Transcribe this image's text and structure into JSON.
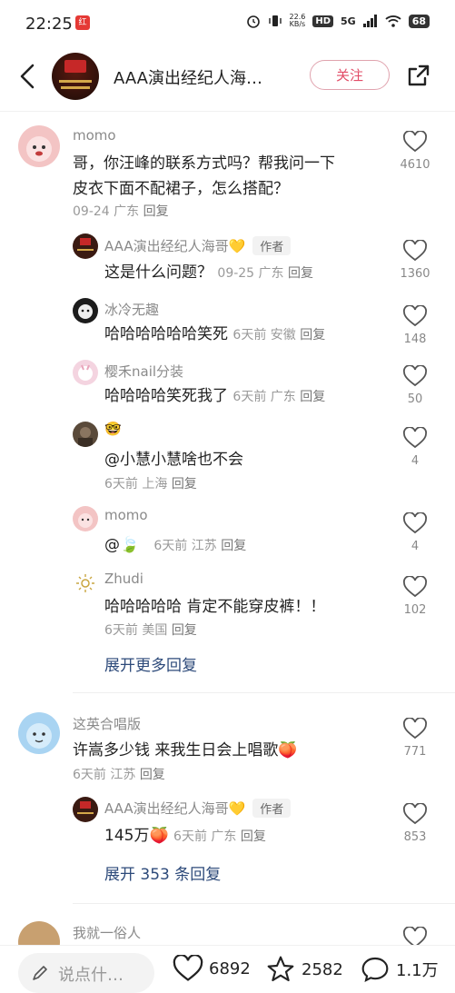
{
  "status_bar": {
    "time": "22:25",
    "app_icon_label": "红",
    "net_speed_value": "22.6",
    "net_speed_unit": "KB/s",
    "hd": "HD",
    "network": "5G",
    "battery": "68"
  },
  "header": {
    "title": "AAA演出经纪人海…",
    "follow_label": "关注"
  },
  "comments": [
    {
      "username": "momo",
      "text_lines": [
        "哥，你汪峰的联系方式吗？帮我问一下",
        "皮衣下面不配裙子，怎么搭配？"
      ],
      "meta": "09-24 广东",
      "reply_label": "回复",
      "likes": "4610",
      "avatar_color": "#f3c4c4",
      "replies": [
        {
          "username": "AAA演出经纪人海哥💛",
          "tag": "作者",
          "text": "这是什么问题？",
          "meta_inline": "09-25 广东",
          "reply_label": "回复",
          "likes": "1360",
          "avatar_color": "#3a1a12"
        },
        {
          "username": "冰冷无趣",
          "text": "哈哈哈哈哈哈笑死",
          "meta_inline": "6天前 安徽",
          "reply_label": "回复",
          "likes": "148",
          "avatar_color": "#1c1c1c"
        },
        {
          "username": "樱禾nail分装",
          "text": "哈哈哈哈笑死我了",
          "meta_inline": "6天前 广东",
          "reply_label": "回复",
          "likes": "50",
          "avatar_color": "#f4d4e0"
        },
        {
          "username": "🤓",
          "text": "@小慧小慧啥也不会",
          "meta": "6天前 上海",
          "reply_label": "回复",
          "likes": "4",
          "avatar_color": "#5a4a3a"
        },
        {
          "username": "momo",
          "text": "@🍃",
          "meta_inline": "6天前 江苏",
          "reply_label": "回复",
          "likes": "4",
          "avatar_color": "#f3c4c4"
        },
        {
          "username": "Zhudi",
          "text": "哈哈哈哈哈 肯定不能穿皮裤！！",
          "meta": "6天前 美国",
          "reply_label": "回复",
          "likes": "102",
          "avatar_color": "#ffffff"
        }
      ],
      "expand_label": "展开更多回复"
    },
    {
      "username": "这英合唱版",
      "text_lines": [
        "许嵩多少钱 来我生日会上唱歌🍑"
      ],
      "meta": "6天前 江苏",
      "reply_label": "回复",
      "likes": "771",
      "avatar_color": "#a9d4f2",
      "replies": [
        {
          "username": "AAA演出经纪人海哥💛",
          "tag": "作者",
          "text": "145万🍑",
          "meta_inline": "6天前 广东",
          "reply_label": "回复",
          "likes": "853",
          "avatar_color": "#3a1a12"
        }
      ],
      "expand_label": "展开 353 条回复"
    },
    {
      "username": "我就一俗人",
      "avatar_color": "#c8a070"
    }
  ],
  "bottom_bar": {
    "input_placeholder": "说点什…",
    "likes": "6892",
    "stars": "2582",
    "comments": "1.1万"
  }
}
